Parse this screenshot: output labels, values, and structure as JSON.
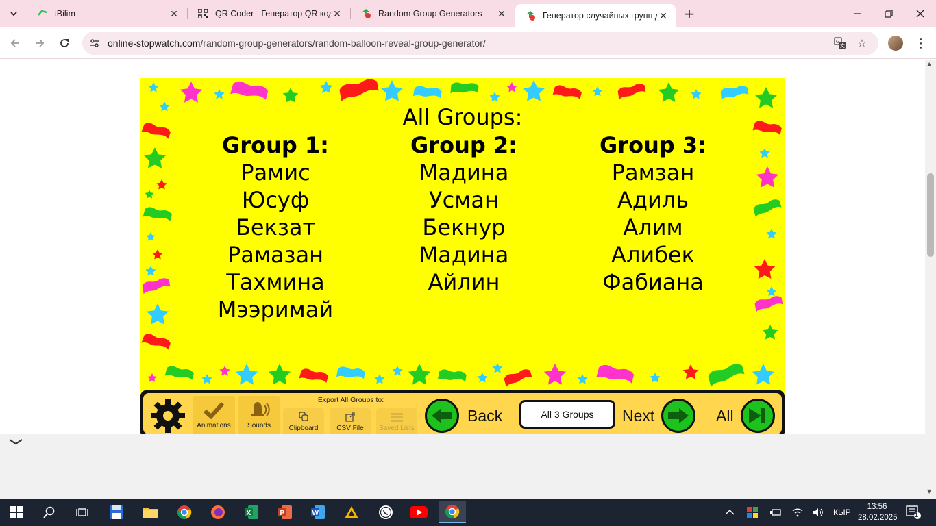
{
  "browser": {
    "tabs": [
      {
        "title": "iBilim",
        "active": false
      },
      {
        "title": "QR Coder - Генератор QR кодов",
        "active": false
      },
      {
        "title": "Random Group Generators",
        "active": false
      },
      {
        "title": "Генератор случайных групп для",
        "active": true
      }
    ],
    "url_domain": "online-stopwatch.com",
    "url_path": "/random-group-generators/random-balloon-reveal-group-generator/"
  },
  "page": {
    "title": "All Groups:",
    "groups": [
      {
        "heading": "Group 1:",
        "members": [
          "Рамис",
          "Юсуф",
          "Бекзат",
          "Рамазан",
          "Тахмина",
          "Мээримай"
        ]
      },
      {
        "heading": "Group 2:",
        "members": [
          "Мадина",
          "Усман",
          "Бекнур",
          "Мадина",
          "Айлин"
        ]
      },
      {
        "heading": "Group 3:",
        "members": [
          "Рамзан",
          "Адиль",
          "Алим",
          "Алибек",
          "Фабиана"
        ]
      }
    ],
    "controls": {
      "animations": "Animations",
      "sounds": "Sounds",
      "export_label": "Export All Groups to:",
      "clipboard": "Clipboard",
      "csv": "CSV File",
      "saved_lists": "Saved Lists",
      "back": "Back",
      "group_select": "All 3 Groups",
      "next": "Next",
      "all": "All"
    }
  },
  "taskbar": {
    "language": "КЫР",
    "time": "13:56",
    "date": "28.02.2025",
    "notifications": "1"
  }
}
